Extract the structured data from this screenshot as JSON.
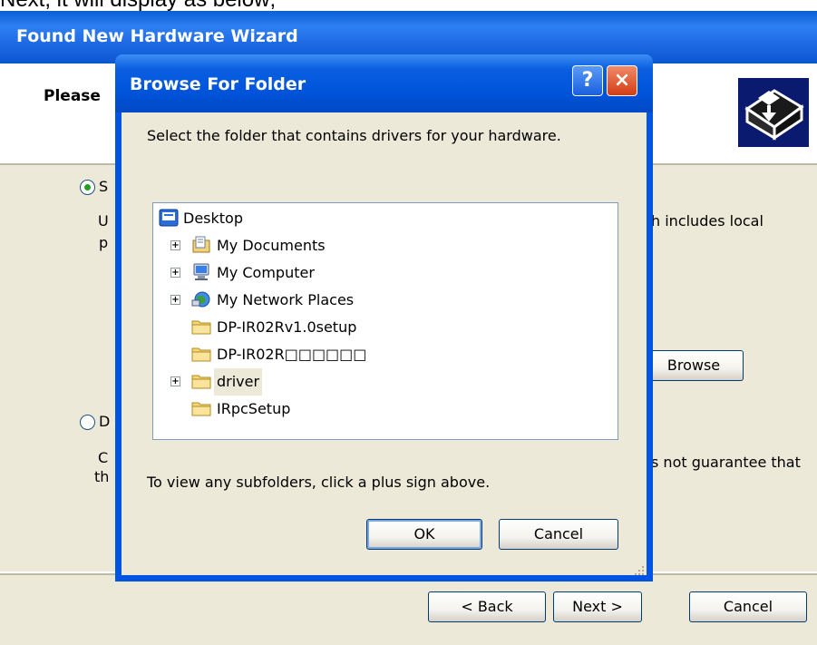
{
  "caption": "Next, it will display as below;",
  "wizard": {
    "title": "Found New Hardware Wizard",
    "heading": "Please",
    "icon": "hardware-install-icon",
    "option1": {
      "letter": "S",
      "line2_start": "U",
      "line3_start": "p",
      "right_text": "h includes local",
      "checked": true
    },
    "browse_label": "Browse",
    "option2": {
      "letter": "D",
      "line2_start": "C",
      "line3_start": "th",
      "right_text": "s not guarantee that",
      "checked": false
    },
    "back_label": "< Back",
    "next_label": "Next >",
    "cancel_label": "Cancel"
  },
  "dialog": {
    "title": "Browse For Folder",
    "help_label": "?",
    "close_label": "×",
    "instruction": "Select the folder that contains drivers for your hardware.",
    "tree": [
      {
        "label": "Desktop",
        "icon": "desktop-icon",
        "expandable": false
      },
      {
        "label": "My Documents",
        "icon": "my-documents-icon",
        "expandable": true
      },
      {
        "label": "My Computer",
        "icon": "my-computer-icon",
        "expandable": true
      },
      {
        "label": "My Network Places",
        "icon": "network-places-icon",
        "expandable": true
      },
      {
        "label": "DP-IR02Rv1.0setup",
        "icon": "folder-icon",
        "expandable": false
      },
      {
        "label": "DP-IR02R□□□□□□",
        "icon": "folder-icon",
        "expandable": false
      },
      {
        "label": "driver",
        "icon": "folder-icon",
        "expandable": true,
        "selected": true
      },
      {
        "label": "IRpcSetup",
        "icon": "folder-icon",
        "expandable": false
      }
    ],
    "hint": "To view any subfolders, click a plus sign above.",
    "ok_label": "OK",
    "cancel_label": "Cancel"
  },
  "colors": {
    "title_bar": "#0054e3",
    "dialog_face": "#ece9d8",
    "close_button": "#d43c14",
    "radio_dot": "#21a121"
  }
}
